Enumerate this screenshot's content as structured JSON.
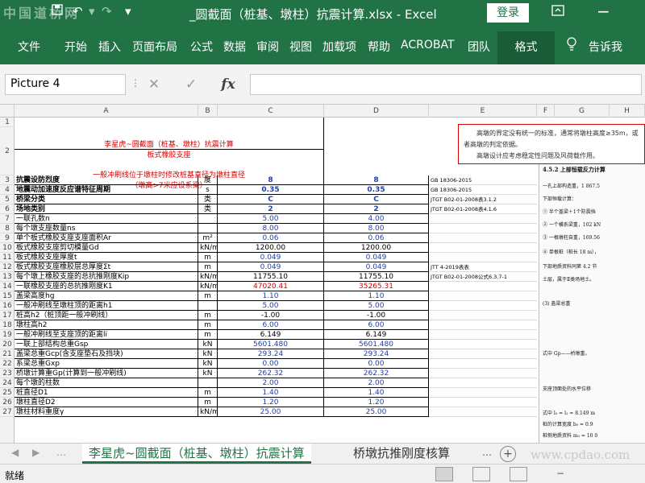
{
  "titlebar": {
    "watermark": "中国道桥网",
    "save_icon": "save-icon",
    "undo_icon": "undo-icon",
    "redo_icon": "redo-icon",
    "title": "_圆截面（桩基、墩柱）抗震计算.xlsx  -  Excel",
    "login": "登录"
  },
  "ribbon": {
    "tabs": [
      "文件",
      "开始",
      "插入",
      "页面布局",
      "公式",
      "数据",
      "审阅",
      "视图",
      "加载项",
      "帮助",
      "ACROBAT",
      "团队"
    ],
    "format_tab": "格式",
    "tell_me": "告诉我"
  },
  "formula_bar": {
    "name_box": "Picture 4",
    "cancel_symbol": "✕",
    "enter_symbol": "✓",
    "fx_symbol": "fx",
    "formula": ""
  },
  "columns": [
    "A",
    "B",
    "C",
    "D",
    "E",
    "F",
    "G",
    "H"
  ],
  "header": {
    "line1": "李星虎~圆截面（桩基、墩柱）抗震计算",
    "line2": "板式橡胶支座",
    "line3": "一般冲刷线位于墩柱时修改桩基直径为墩柱直径",
    "line4": "（墩高>7米应设系梁）"
  },
  "note": {
    "p1": "高墩的界定没有统一的标准，通常将墩柱高度≥35m，或者高墩的判定依据。",
    "p2": "高墩设计应考虑稳定性问题及风荷载作用。"
  },
  "rows": [
    {
      "n": "3",
      "a": "抗震设防烈度",
      "b": "度",
      "c": "8",
      "d": "8",
      "e": "GB 18306-2015",
      "cls": "bold"
    },
    {
      "n": "4",
      "a": "地震动加速度反应谱特征周期",
      "b": "s",
      "c": "0.35",
      "d": "0.35",
      "e": "GB 18306-2015",
      "cls": "bold"
    },
    {
      "n": "5",
      "a": "桥梁分类",
      "b": "类",
      "c": "C",
      "d": "C",
      "e": "JTGT B02-01-2008表3.1.2",
      "cls": "bold"
    },
    {
      "n": "6",
      "a": "场地类别",
      "b": "类",
      "c": "2",
      "d": "2",
      "e": "JTGT B02-01-2008表4.1.6",
      "cls": "bold"
    },
    {
      "n": "7",
      "a": "一联孔数n",
      "b": "",
      "c": "5.00",
      "d": "4.00",
      "e": "",
      "cls": ""
    },
    {
      "n": "8",
      "a": "每个墩支座数量ns",
      "b": "",
      "c": "8.00",
      "d": "8.00",
      "e": "",
      "cls": ""
    },
    {
      "n": "9",
      "a": "单个板式橡胶支座支座面积Ar",
      "b": "m²",
      "c": "0.06",
      "d": "0.06",
      "e": "",
      "cls": ""
    },
    {
      "n": "10",
      "a": "板式橡胶支座剪切模量Gd",
      "b": "kN/m²",
      "c": "1200.00",
      "d": "1200.00",
      "e": "",
      "cls": "blk"
    },
    {
      "n": "11",
      "a": "板式橡胶支座厚度t",
      "b": "m",
      "c": "0.049",
      "d": "0.049",
      "e": "",
      "cls": ""
    },
    {
      "n": "12",
      "a": "板式橡胶支座橡胶层总厚度Σt",
      "b": "m",
      "c": "0.049",
      "d": "0.049",
      "e": "JTT 4-2019表表",
      "cls": ""
    },
    {
      "n": "13",
      "a": "每个墩上橡胶支座的总抗推刚度Kip",
      "b": "kN/m",
      "c": "11755.10",
      "d": "11755.10",
      "e": "JTGT B02-01-2008公式6.3.7-1",
      "cls": "blk"
    },
    {
      "n": "14",
      "a": "一联橡胶支座的总抗推刚度K1",
      "b": "kN/m",
      "c": "47020.41",
      "d": "35265.31",
      "e": "",
      "cls": "red"
    },
    {
      "n": "15",
      "a": "盖梁高度hg",
      "b": "m",
      "c": "1.10",
      "d": "1.10",
      "e": "",
      "cls": ""
    },
    {
      "n": "16",
      "a": "一般冲刷线至墩柱顶的距离h1",
      "b": "",
      "c": "5.00",
      "d": "5.00",
      "e": "",
      "cls": ""
    },
    {
      "n": "17",
      "a": "桩高h2（桩顶距一般冲刷线）",
      "b": "m",
      "c": "-1.00",
      "d": "-1.00",
      "e": "",
      "cls": "blk"
    },
    {
      "n": "18",
      "a": "墩柱高h2",
      "b": "m",
      "c": "6.00",
      "d": "6.00",
      "e": "",
      "cls": ""
    },
    {
      "n": "19",
      "a": "一般冲刷线至支座顶的距离li",
      "b": "m",
      "c": "6.149",
      "d": "6.149",
      "e": "",
      "cls": "blk"
    },
    {
      "n": "20",
      "a": "一联上部结构总重Gsp",
      "b": "kN",
      "c": "5601.480",
      "d": "5601.480",
      "e": "",
      "cls": ""
    },
    {
      "n": "21",
      "a": "盖梁总重Gcp(含支座垫石及挡块)",
      "b": "kN",
      "c": "293.24",
      "d": "293.24",
      "e": "",
      "cls": ""
    },
    {
      "n": "22",
      "a": "系梁总重Gxp",
      "b": "kN",
      "c": "0.00",
      "d": "0.00",
      "e": "",
      "cls": ""
    },
    {
      "n": "23",
      "a": "桥墩计算重Gp(计算到一般冲刷线)",
      "b": "kN",
      "c": "262.32",
      "d": "262.32",
      "e": "",
      "cls": ""
    },
    {
      "n": "24",
      "a": "每个墩的柱数",
      "b": "",
      "c": "2.00",
      "d": "2.00",
      "e": "",
      "cls": ""
    },
    {
      "n": "25",
      "a": "桩直径D1",
      "b": "m",
      "c": "1.40",
      "d": "1.40",
      "e": "",
      "cls": ""
    },
    {
      "n": "26",
      "a": "墩柱直径D2",
      "b": "m",
      "c": "1.20",
      "d": "1.20",
      "e": "",
      "cls": ""
    },
    {
      "n": "27",
      "a": "墩柱材料重度γ",
      "b": "kN/m³",
      "c": "25.00",
      "d": "25.00",
      "e": "",
      "cls": ""
    }
  ],
  "doc_image": {
    "lines": [
      "4.5.2  上部恒载反力计算",
      "一孔上部构造重，1 867.5",
      "下部恒载计算：",
      "① 半个盖梁＋1个防震挡",
      "② 一个横系梁重，102 kN",
      "③ 一根墩柱自重，169.56",
      "④ 单根桩（桩长 18 m），",
      "下部地质资料同第 4.2 节",
      "土层，属于Ⅱ类场地土。",
      "(3) 盖梁总重",
      "式中  Gp——桥墩重。",
      "支座顶面处的水平位移",
      "式中 l₀ = l₁ = 8.149 m",
      "桩的计算宽度 b₀ = 0.9",
      "桩侧地质资料 m₀ = 10 0",
      "3) 确定 Sₕ₁",
      "根据《抗震细则》第 5.2.1"
    ]
  },
  "sheets": {
    "active": "李星虎~圆截面（桩基、墩柱）抗震计算",
    "second": "桥墩抗推刚度核算",
    "watermark": "www.cpdao.com"
  },
  "status": {
    "ready": "就绪",
    "zoom_minus": "−"
  },
  "colors": {
    "excel_green": "#217346",
    "note_border": "#d80000",
    "value_blue": "#1f3fa8"
  }
}
